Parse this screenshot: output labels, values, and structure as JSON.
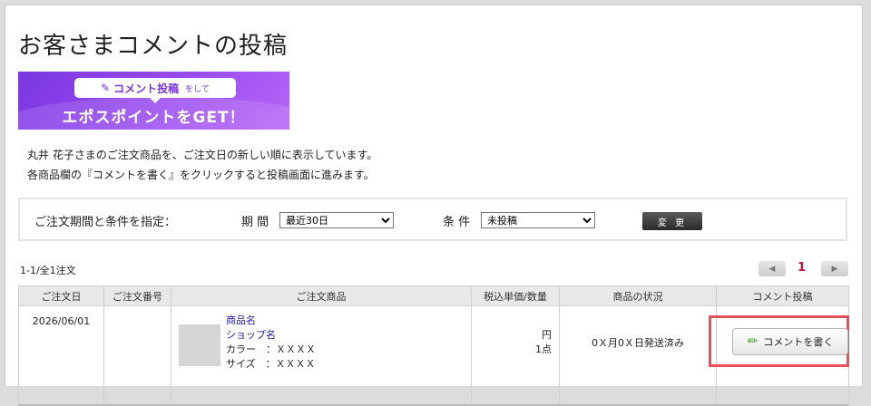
{
  "page": {
    "title": "お客さまコメントの投稿"
  },
  "banner": {
    "pill_text": "コメント投稿",
    "pill_suffix": "をして",
    "headline": "エポスポイントをGET！"
  },
  "intro": {
    "line1": "丸井 花子さまのご注文商品を、ご注文日の新しい順に表示しています。",
    "line2": "各商品欄の『コメントを書く』をクリックすると投稿画面に進みます。"
  },
  "filter": {
    "heading": "ご注文期間と条件を指定：",
    "period_label": "期 間",
    "period_value": "最近30日",
    "condition_label": "条 件",
    "condition_value": "未投稿",
    "change_button": "変 更"
  },
  "results": {
    "count_text": "1-1/全1注文",
    "current_page": "1",
    "prev": "◀",
    "next": "▶"
  },
  "table": {
    "headers": [
      "ご注文日",
      "ご注文番号",
      "ご注文商品",
      "税込単価/数量",
      "商品の状況",
      "コメント投稿"
    ],
    "rows": [
      {
        "date": "2026/06/01",
        "order_no": "",
        "product_name": "商品名",
        "shop_name": "ショップ名",
        "color": "カラー　：ＸＸＸＸ",
        "size": "サイズ　：ＸＸＸＸ",
        "price": "円",
        "quantity": "1点",
        "status": "0Ｘ月0Ｘ日発送済み",
        "action": "コメントを書く"
      }
    ]
  },
  "colors": {
    "banner_purple": "#8a42ea",
    "highlight_red": "#ec4f5a",
    "page_num": "#c0143c",
    "link_blue": "#1a1aa6"
  }
}
